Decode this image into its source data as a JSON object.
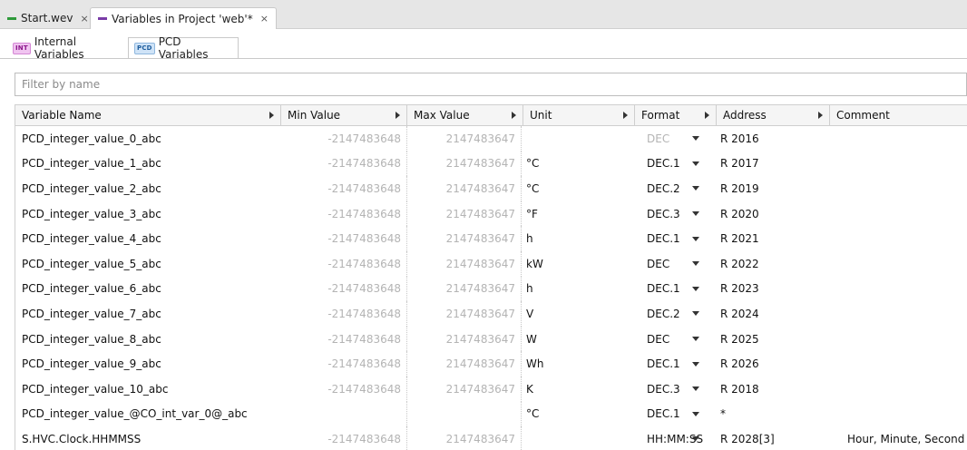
{
  "editor_tabs": [
    {
      "label": "Start.wev",
      "close": "×"
    },
    {
      "label": "Variables in Project 'web'*",
      "close": "×"
    }
  ],
  "inner_tabs": [
    {
      "badge": "INT",
      "label": "Internal Variables"
    },
    {
      "badge": "PCD",
      "label": "PCD Variables"
    }
  ],
  "filter": {
    "placeholder": "Filter by name",
    "value": ""
  },
  "columns": {
    "name": "Variable Name",
    "min": "Min Value",
    "max": "Max Value",
    "unit": "Unit",
    "format": "Format",
    "address": "Address",
    "comment": "Comment"
  },
  "rows": [
    {
      "name": "PCD_integer_value_0_abc",
      "min": "-2147483648",
      "max": "2147483647",
      "unit": "",
      "format": "DEC",
      "address": "R 2016",
      "comment": ""
    },
    {
      "name": "PCD_integer_value_1_abc",
      "min": "-2147483648",
      "max": "2147483647",
      "unit": "°C",
      "format": "DEC.1",
      "address": "R 2017",
      "comment": ""
    },
    {
      "name": "PCD_integer_value_2_abc",
      "min": "-2147483648",
      "max": "2147483647",
      "unit": "°C",
      "format": "DEC.2",
      "address": "R 2019",
      "comment": ""
    },
    {
      "name": "PCD_integer_value_3_abc",
      "min": "-2147483648",
      "max": "2147483647",
      "unit": "°F",
      "format": "DEC.3",
      "address": "R 2020",
      "comment": ""
    },
    {
      "name": "PCD_integer_value_4_abc",
      "min": "-2147483648",
      "max": "2147483647",
      "unit": "h",
      "format": "DEC.1",
      "address": "R 2021",
      "comment": ""
    },
    {
      "name": "PCD_integer_value_5_abc",
      "min": "-2147483648",
      "max": "2147483647",
      "unit": "kW",
      "format": "DEC",
      "address": "R 2022",
      "comment": ""
    },
    {
      "name": "PCD_integer_value_6_abc",
      "min": "-2147483648",
      "max": "2147483647",
      "unit": "h",
      "format": "DEC.1",
      "address": "R 2023",
      "comment": ""
    },
    {
      "name": "PCD_integer_value_7_abc",
      "min": "-2147483648",
      "max": "2147483647",
      "unit": "V",
      "format": "DEC.2",
      "address": "R 2024",
      "comment": ""
    },
    {
      "name": "PCD_integer_value_8_abc",
      "min": "-2147483648",
      "max": "2147483647",
      "unit": "W",
      "format": "DEC",
      "address": "R 2025",
      "comment": ""
    },
    {
      "name": "PCD_integer_value_9_abc",
      "min": "-2147483648",
      "max": "2147483647",
      "unit": "Wh",
      "format": "DEC.1",
      "address": "R 2026",
      "comment": ""
    },
    {
      "name": "PCD_integer_value_10_abc",
      "min": "-2147483648",
      "max": "2147483647",
      "unit": "K",
      "format": "DEC.3",
      "address": "R 2018",
      "comment": ""
    },
    {
      "name": "PCD_integer_value_@CO_int_var_0@_abc",
      "min": "",
      "max": "",
      "unit": "°C",
      "format": "DEC.1",
      "address": "*",
      "comment": ""
    },
    {
      "name": "S.HVC.Clock.HHMMSS",
      "min": "-2147483648",
      "max": "2147483647",
      "unit": "",
      "format": "HH:MM:SS",
      "address": "R 2028[3]",
      "comment": "Hour, Minute, Second"
    }
  ],
  "colors": {
    "accent_int": "#8a168a",
    "accent_pcd": "#1d5c9c",
    "dimmed_text": "#b4b4b4"
  }
}
